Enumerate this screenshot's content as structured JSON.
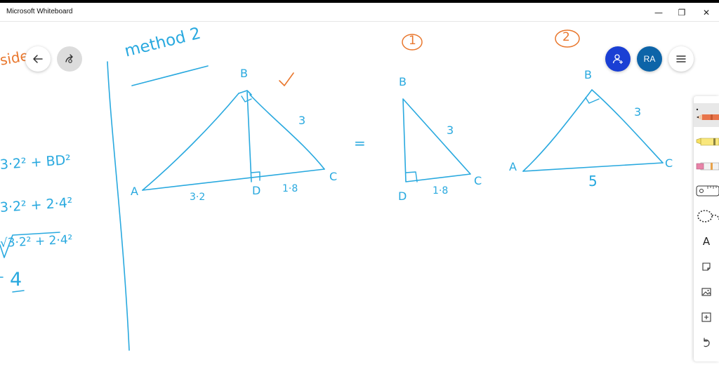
{
  "window": {
    "title": "Microsoft Whiteboard",
    "minimize_glyph": "—",
    "maximize_glyph": "❐",
    "close_glyph": "✕"
  },
  "controls": {
    "back_icon": "arrow-left-icon",
    "share_icon": "share-icon",
    "invite_icon": "add-person-icon",
    "avatar_initials": "RA",
    "menu_icon": "hamburger-menu-icon"
  },
  "colors": {
    "ink_blue": "#29a9df",
    "ink_orange": "#e9772d",
    "invite_button": "#1a3fd4",
    "avatar": "#0d64a8"
  },
  "ink_left": {
    "word_fragment": "side",
    "line1": "3·2² + BD²",
    "line2": "3·2² + 2·4²",
    "line3": "√3·2² + 2·4²",
    "answer": "4"
  },
  "method_heading": "method 2",
  "figure_main": {
    "vertex_a": "A",
    "vertex_b": "B",
    "vertex_c": "C",
    "vertex_d": "D",
    "side_bc": "3",
    "segment_ad": "3·2",
    "segment_dc": "1·8"
  },
  "equals_sign": "=",
  "figure_1": {
    "label": "1",
    "vertex_b": "B",
    "vertex_d": "D",
    "vertex_c": "C",
    "side_bc": "3",
    "side_dc": "1·8"
  },
  "figure_2": {
    "label": "2",
    "vertex_a": "A",
    "vertex_b": "B",
    "vertex_c": "C",
    "side_bc": "3",
    "side_ac": "5"
  },
  "toolbar": {
    "tools": [
      {
        "name": "pen-black",
        "icon": "pen-icon"
      },
      {
        "name": "highlighter-yellow",
        "icon": "highlighter-icon"
      },
      {
        "name": "eraser",
        "icon": "eraser-icon"
      },
      {
        "name": "ruler",
        "icon": "ruler-icon"
      },
      {
        "name": "lasso",
        "icon": "lasso-icon"
      },
      {
        "name": "text",
        "icon": "text-icon",
        "glyph": "A"
      },
      {
        "name": "sticky-note",
        "icon": "sticky-note-icon"
      },
      {
        "name": "image",
        "icon": "image-icon"
      },
      {
        "name": "insert",
        "icon": "insert-icon"
      },
      {
        "name": "undo",
        "icon": "undo-icon"
      }
    ],
    "selected": "pen-black"
  }
}
